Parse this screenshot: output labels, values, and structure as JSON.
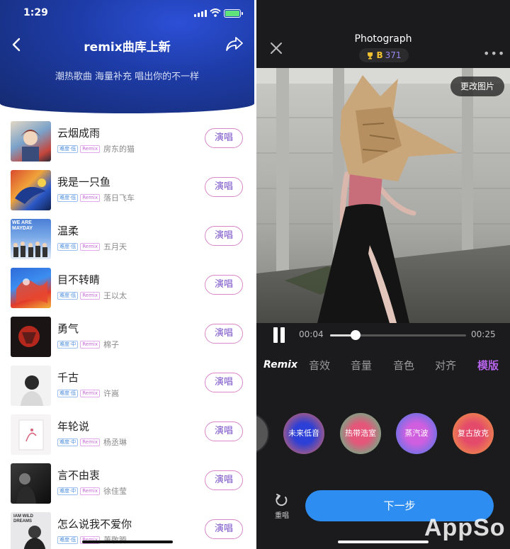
{
  "left": {
    "status": {
      "time": "1:29"
    },
    "nav": {
      "title": "remix曲库上新"
    },
    "subtitle": "潮热歌曲 海量补充 唱出你的不一样",
    "sing_label": "演唱",
    "songs": [
      {
        "title": "云烟成雨",
        "difficulty": "难度·低",
        "remix": "Remix",
        "artist": "房东的猫"
      },
      {
        "title": "我是一只鱼",
        "difficulty": "难度·低",
        "remix": "Remix",
        "artist": "落日飞车"
      },
      {
        "title": "温柔",
        "difficulty": "难度·低",
        "remix": "Remix",
        "artist": "五月天",
        "cover_text": "WE ARE MAYDAY"
      },
      {
        "title": "目不转睛",
        "difficulty": "难度·低",
        "remix": "Remix",
        "artist": "王以太"
      },
      {
        "title": "勇气",
        "difficulty": "难度·中",
        "remix": "Remix",
        "artist": "棉子"
      },
      {
        "title": "千古",
        "difficulty": "难度·低",
        "remix": "Remix",
        "artist": "许嵩"
      },
      {
        "title": "年轮说",
        "difficulty": "难度·中",
        "remix": "Remix",
        "artist": "杨丞琳"
      },
      {
        "title": "言不由衷",
        "difficulty": "难度·中",
        "remix": "Remix",
        "artist": "徐佳莹"
      },
      {
        "title": "怎么说我不爱你",
        "difficulty": "难度·低",
        "remix": "Remix",
        "artist": "萧敬腾",
        "cover_text": "IAM WILD DREAMS"
      }
    ]
  },
  "right": {
    "title": "Photograph",
    "badge": {
      "letter": "B",
      "count": "371"
    },
    "change_image": "更改图片",
    "player": {
      "current": "00:04",
      "total": "00:25",
      "progress": 0.19
    },
    "tabs": [
      "Remix",
      "音效",
      "音量",
      "音色",
      "对齐",
      "模版"
    ],
    "active_tab": "模版",
    "effects": [
      {
        "label": "未来低音",
        "colors": [
          "#2c3fd6",
          "#e86a5a"
        ]
      },
      {
        "label": "热带浩室",
        "colors": [
          "#e4577a",
          "#3fd18a"
        ]
      },
      {
        "label": "蒸汽波",
        "colors": [
          "#d05fe0",
          "#3b7ae8"
        ]
      },
      {
        "label": "复古放克",
        "colors": [
          "#e44a6a",
          "#f0a040"
        ]
      }
    ],
    "redo_label": "重唱",
    "next_label": "下一步",
    "watermark": "AppSo"
  }
}
